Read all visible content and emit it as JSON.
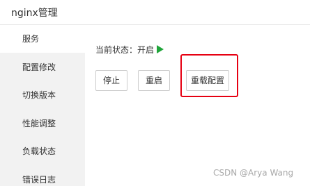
{
  "header": {
    "title": "nginx管理"
  },
  "sidebar": {
    "items": [
      {
        "label": "服务",
        "active": true
      },
      {
        "label": "配置修改",
        "active": false
      },
      {
        "label": "切换版本",
        "active": false
      },
      {
        "label": "性能调整",
        "active": false
      },
      {
        "label": "负载状态",
        "active": false
      },
      {
        "label": "错误日志",
        "active": false
      }
    ]
  },
  "main": {
    "status_text": "当前状态：开启",
    "status_icon": "play-icon",
    "status_color": "#20a53a",
    "buttons": {
      "stop_label": "停止",
      "restart_label": "重启",
      "reload_label": "重载配置"
    },
    "highlight_color": "#e60012"
  },
  "watermark": "CSDN @Arya Wang"
}
